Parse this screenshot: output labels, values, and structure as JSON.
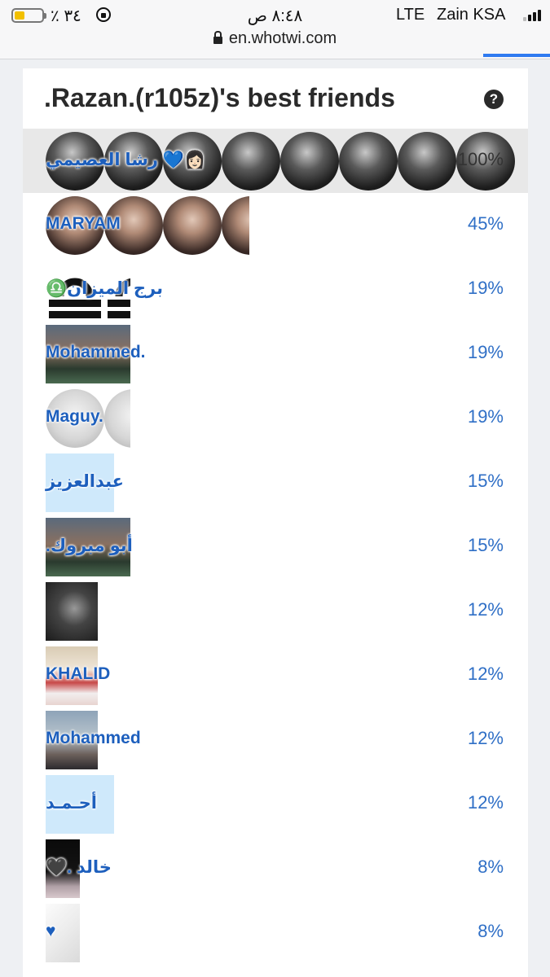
{
  "status_bar": {
    "battery_text": "٪ ٣٤",
    "battery_level": 0.34,
    "clock": "٨:٤٨ ص",
    "network": "LTE",
    "carrier": "Zain KSA",
    "url": "en.whotwi.com"
  },
  "page": {
    "title": ".Razan.(r105z)'s best friends",
    "help_icon": "question-circle-icon"
  },
  "friends": [
    {
      "name": "رشا العصيمي 💙👩🏻",
      "percent": "100%",
      "avatar_style": "circle-dark"
    },
    {
      "name": "MARYAM",
      "percent": "45%",
      "avatar_style": "circle-blonde"
    },
    {
      "name": "♎️برج الميزان",
      "percent": "19%",
      "avatar_style": "libra-symbol"
    },
    {
      "name": "Mohammed.",
      "percent": "19%",
      "avatar_style": "photo-man"
    },
    {
      "name": "Maguy.",
      "percent": "19%",
      "avatar_style": "circle-sketch"
    },
    {
      "name": "عبدالعزيز",
      "percent": "15%",
      "avatar_style": "light-blue"
    },
    {
      "name": ".أبو مبروك",
      "percent": "15%",
      "avatar_style": "photo-man"
    },
    {
      "name": "",
      "percent": "12%",
      "avatar_style": "dark-hand"
    },
    {
      "name": "KHALID",
      "percent": "12%",
      "avatar_style": "photo-shemagh"
    },
    {
      "name": "Mohammed",
      "percent": "12%",
      "avatar_style": "sky-photo"
    },
    {
      "name": "أحـمـد",
      "percent": "12%",
      "avatar_style": "light-blue"
    },
    {
      "name": "🖤. خالد",
      "percent": "8%",
      "avatar_style": "dark-photo"
    },
    {
      "name": "♥",
      "percent": "8%",
      "avatar_style": "sketch-light"
    }
  ],
  "colors": {
    "link_blue": "#1d5fbd",
    "percent_blue": "#2f6fc6",
    "progress_blue": "#2f7af0",
    "battery_yellow": "#f2c000"
  }
}
